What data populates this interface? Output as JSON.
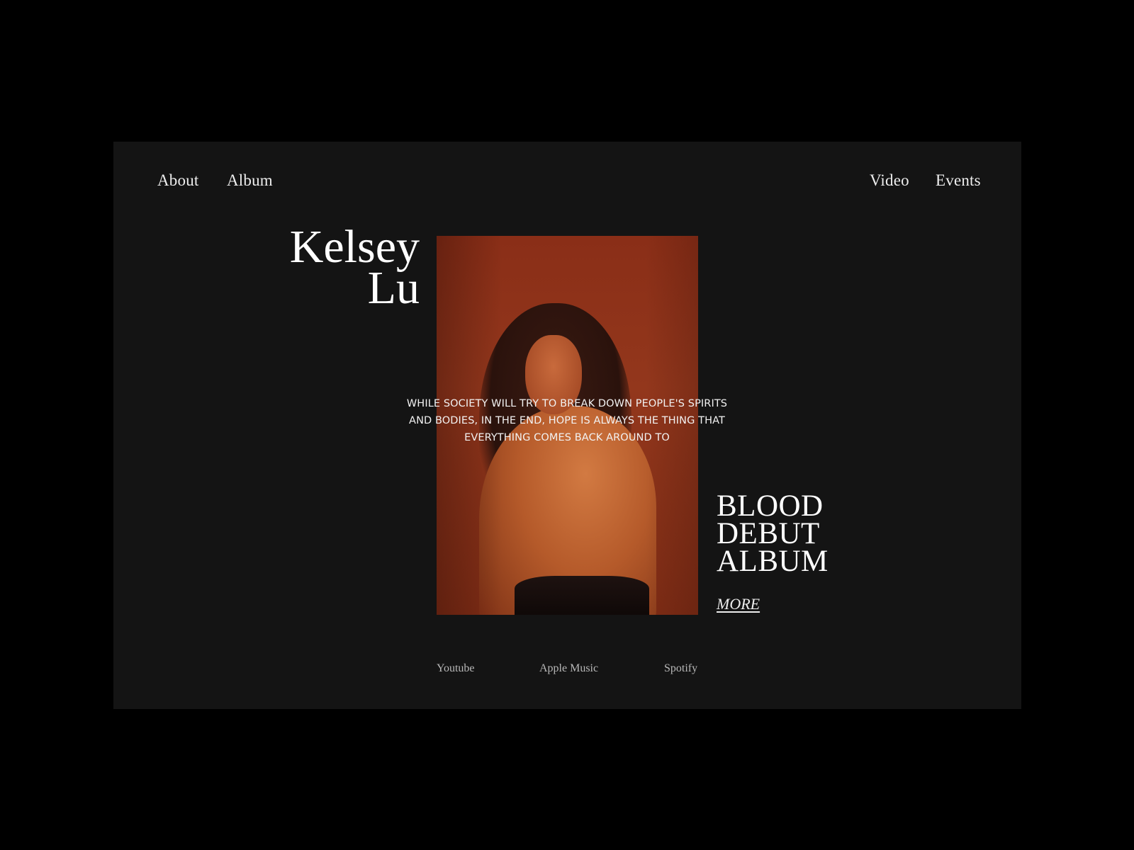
{
  "nav": {
    "left": [
      {
        "label": "About"
      },
      {
        "label": "Album"
      }
    ],
    "right": [
      {
        "label": "Video"
      },
      {
        "label": "Events"
      }
    ]
  },
  "artist": {
    "first_name": "Kelsey",
    "last_name": "Lu"
  },
  "hero": {
    "image_description": "Portrait photo of artist on red-orange background",
    "quote_lines": [
      "WHILE SOCIETY WILL TRY TO BREAK DOWN PEOPLE'S SPIRITS",
      "AND BODIES, IN THE END, HOPE IS ALWAYS THE THING THAT",
      "EVERYTHING COMES BACK AROUND TO"
    ]
  },
  "album": {
    "title_lines": [
      "BLOOD",
      "DEBUT",
      "ALBUM"
    ],
    "more_label": "MORE"
  },
  "streaming": [
    {
      "label": "Youtube"
    },
    {
      "label": "Apple Music"
    },
    {
      "label": "Spotify"
    }
  ],
  "colors": {
    "page_bg": "#000000",
    "card_bg": "#141414",
    "photo_bg": "#8a2e17",
    "text": "#ffffff"
  }
}
